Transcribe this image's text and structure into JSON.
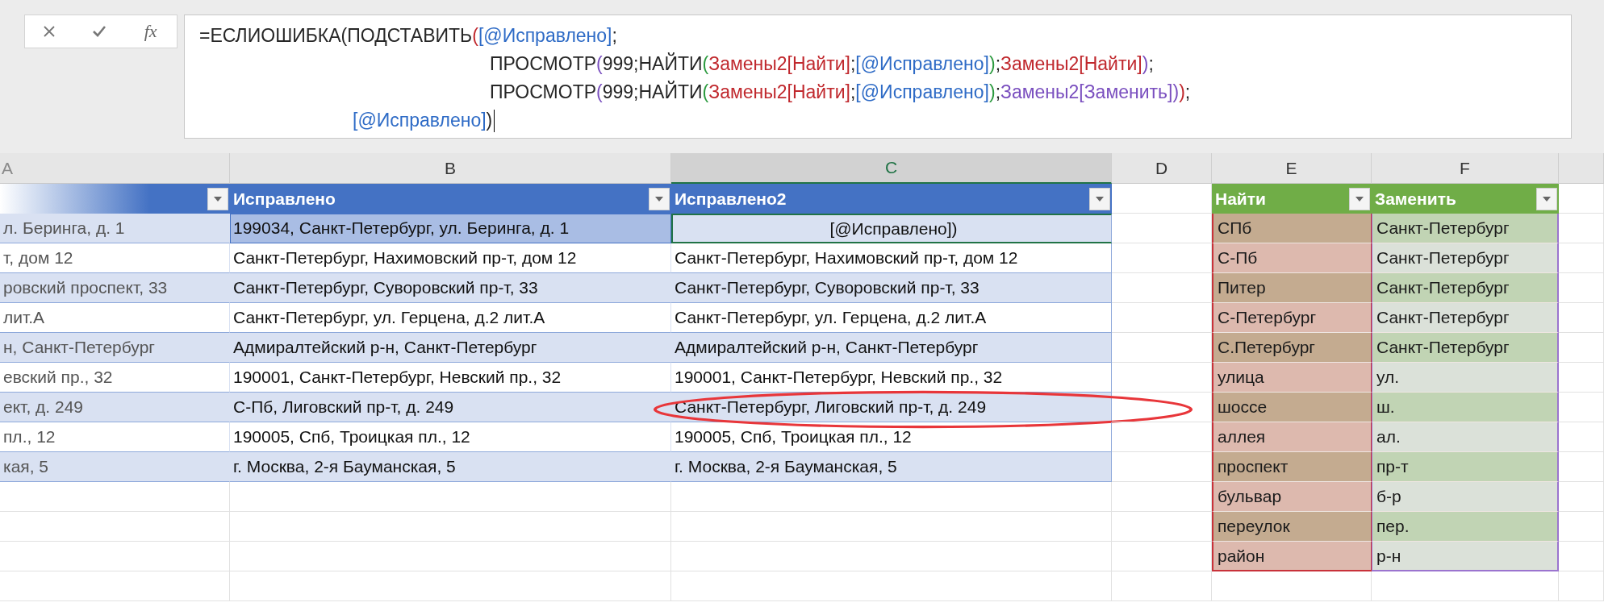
{
  "formula_bar": {
    "function_label": "fx",
    "lines": [
      {
        "kind": "start",
        "segments": [
          {
            "text": "=ЕСЛИОШИБКА(ПОДСТАВИТЬ",
            "color": "#262626"
          },
          {
            "text": "(",
            "color": "#c0282d"
          },
          {
            "text": "[@Исправлено]",
            "color": "#2e6bc6"
          },
          {
            "text": ";",
            "color": "#262626"
          }
        ]
      },
      {
        "kind": "argument",
        "segments": [
          {
            "text": "ПРОСМОТР",
            "color": "#262626"
          },
          {
            "text": "(",
            "color": "#7a4fbf"
          },
          {
            "text": "999;НАЙТИ",
            "color": "#262626"
          },
          {
            "text": "(",
            "color": "#2b9a3e"
          },
          {
            "text": "Замены2[Найти]",
            "color": "#c0282d"
          },
          {
            "text": ";",
            "color": "#262626"
          },
          {
            "text": "[@Исправлено]",
            "color": "#2e6bc6"
          },
          {
            "text": ")",
            "color": "#2b9a3e"
          },
          {
            "text": ";",
            "color": "#262626"
          },
          {
            "text": "Замены2[Найти]",
            "color": "#c0282d"
          },
          {
            "text": ")",
            "color": "#7a4fbf"
          },
          {
            "text": ";",
            "color": "#262626"
          }
        ]
      },
      {
        "kind": "argument",
        "segments": [
          {
            "text": "ПРОСМОТР",
            "color": "#262626"
          },
          {
            "text": "(",
            "color": "#7a4fbf"
          },
          {
            "text": "999;НАЙТИ",
            "color": "#262626"
          },
          {
            "text": "(",
            "color": "#2b9a3e"
          },
          {
            "text": "Замены2[Найти]",
            "color": "#c0282d"
          },
          {
            "text": ";",
            "color": "#262626"
          },
          {
            "text": "[@Исправлено]",
            "color": "#2e6bc6"
          },
          {
            "text": ")",
            "color": "#2b9a3e"
          },
          {
            "text": ";",
            "color": "#262626"
          },
          {
            "text": "Замены2[Заменить]",
            "color": "#7a4fbf"
          },
          {
            "text": ")",
            "color": "#7a4fbf"
          },
          {
            "text": ")",
            "color": "#c0282d"
          },
          {
            "text": ";",
            "color": "#262626"
          }
        ]
      },
      {
        "kind": "closing",
        "segments": [
          {
            "text": "[@Исправлено]",
            "color": "#2e6bc6"
          },
          {
            "text": ")",
            "color": "#262626"
          }
        ]
      }
    ]
  },
  "columns": [
    {
      "label": "A",
      "selected": false
    },
    {
      "label": "B",
      "selected": false
    },
    {
      "label": "C",
      "selected": true
    },
    {
      "label": "D",
      "selected": false
    },
    {
      "label": "E",
      "selected": false
    },
    {
      "label": "F",
      "selected": false
    }
  ],
  "corrections_table": {
    "headers": [
      "Исправлено",
      "Исправлено2"
    ],
    "rows": [
      {
        "cells": [
          {
            "text": "л. Беринга, д. 1",
            "active": false,
            "referenced": false,
            "circled": false
          },
          {
            "text": "199034, Санкт-Петербург, ул. Беринга, д. 1",
            "active": false,
            "referenced": true,
            "circled": false
          },
          {
            "text": "[@Исправлено])",
            "active": true,
            "referenced": false,
            "circled": false
          }
        ]
      },
      {
        "cells": [
          {
            "text": "т, дом 12",
            "active": false,
            "referenced": false,
            "circled": false
          },
          {
            "text": "Санкт-Петербург, Нахимовский пр-т, дом 12",
            "active": false,
            "referenced": false,
            "circled": false
          },
          {
            "text": "Санкт-Петербург, Нахимовский пр-т, дом 12",
            "active": false,
            "referenced": false,
            "circled": false
          }
        ]
      },
      {
        "cells": [
          {
            "text": "ровский проспект, 33",
            "active": false,
            "referenced": false,
            "circled": false
          },
          {
            "text": "Санкт-Петербург, Суворовский пр-т, 33",
            "active": false,
            "referenced": false,
            "circled": false
          },
          {
            "text": "Санкт-Петербург, Суворовский пр-т, 33",
            "active": false,
            "referenced": false,
            "circled": false
          }
        ]
      },
      {
        "cells": [
          {
            "text": "лит.А",
            "active": false,
            "referenced": false,
            "circled": false
          },
          {
            "text": "Санкт-Петербург, ул. Герцена, д.2 лит.А",
            "active": false,
            "referenced": false,
            "circled": false
          },
          {
            "text": "Санкт-Петербург, ул. Герцена, д.2 лит.А",
            "active": false,
            "referenced": false,
            "circled": false
          }
        ]
      },
      {
        "cells": [
          {
            "text": "н, Санкт-Петербург",
            "active": false,
            "referenced": false,
            "circled": false
          },
          {
            "text": "Адмиралтейский р-н, Санкт-Петербург",
            "active": false,
            "referenced": false,
            "circled": false
          },
          {
            "text": "Адмиралтейский р-н, Санкт-Петербург",
            "active": false,
            "referenced": false,
            "circled": false
          }
        ]
      },
      {
        "cells": [
          {
            "text": "евский пр., 32",
            "active": false,
            "referenced": false,
            "circled": false
          },
          {
            "text": "190001, Санкт-Петербург, Невский пр., 32",
            "active": false,
            "referenced": false,
            "circled": false
          },
          {
            "text": "190001, Санкт-Петербург, Невский пр., 32",
            "active": false,
            "referenced": false,
            "circled": false
          }
        ]
      },
      {
        "cells": [
          {
            "text": "ект, д. 249",
            "active": false,
            "referenced": false,
            "circled": false
          },
          {
            "text": "С-Пб, Лиговский пр-т, д. 249",
            "active": false,
            "referenced": false,
            "circled": false
          },
          {
            "text": "Санкт-Петербург, Лиговский пр-т, д. 249",
            "active": false,
            "referenced": false,
            "circled": true
          }
        ]
      },
      {
        "cells": [
          {
            "text": "пл., 12",
            "active": false,
            "referenced": false,
            "circled": false
          },
          {
            "text": "190005, Спб, Троицкая пл., 12",
            "active": false,
            "referenced": false,
            "circled": false
          },
          {
            "text": "190005, Спб, Троицкая пл., 12",
            "active": false,
            "referenced": false,
            "circled": false
          }
        ]
      },
      {
        "cells": [
          {
            "text": "кая, 5",
            "active": false,
            "referenced": false,
            "circled": false
          },
          {
            "text": "г. Москва, 2-я Бауманская, 5",
            "active": false,
            "referenced": false,
            "circled": false
          },
          {
            "text": "г. Москва, 2-я Бауманская, 5",
            "active": false,
            "referenced": false,
            "circled": false
          }
        ]
      }
    ]
  },
  "replacements_table": {
    "headers": [
      "Найти",
      "Заменить"
    ],
    "rows": [
      {
        "find": "СПб",
        "replace": "Санкт-Петербург"
      },
      {
        "find": "С-Пб",
        "replace": "Санкт-Петербург"
      },
      {
        "find": "Питер",
        "replace": "Санкт-Петербург"
      },
      {
        "find": "С-Петербург",
        "replace": "Санкт-Петербург"
      },
      {
        "find": "С.Петербург",
        "replace": "Санкт-Петербург"
      },
      {
        "find": "улица",
        "replace": "ул."
      },
      {
        "find": "шоссе",
        "replace": "ш."
      },
      {
        "find": "аллея",
        "replace": "ал."
      },
      {
        "find": "проспект",
        "replace": "пр-т"
      },
      {
        "find": "бульвар",
        "replace": "б-р"
      },
      {
        "find": "переулок",
        "replace": "пер."
      },
      {
        "find": "район",
        "replace": "р-н"
      }
    ]
  }
}
